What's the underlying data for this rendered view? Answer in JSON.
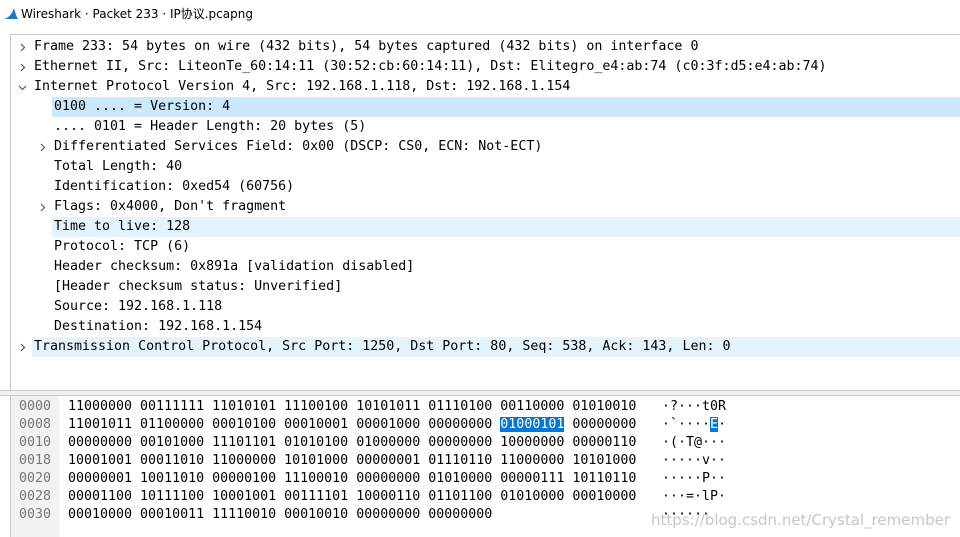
{
  "window": {
    "title": "Wireshark · Packet 233 · IP协议.pcapng",
    "icon": "wireshark-fin-icon",
    "accent": "#1679c5"
  },
  "colors": {
    "selected_row": "#cce8ff",
    "related_row": "#e5f3ff",
    "selected_byte": "#0078d7"
  },
  "tree": {
    "rows": [
      {
        "text": "Frame 233: 54 bytes on wire (432 bits), 54 bytes captured (432 bits) on interface 0",
        "level": 0,
        "toggle": "collapsed",
        "state": ""
      },
      {
        "text": "Ethernet II, Src: LiteonTe_60:14:11 (30:52:cb:60:14:11), Dst: Elitegro_e4:ab:74 (c0:3f:d5:e4:ab:74)",
        "level": 0,
        "toggle": "collapsed",
        "state": ""
      },
      {
        "text": "Internet Protocol Version 4, Src: 192.168.1.118, Dst: 192.168.1.154",
        "level": 0,
        "toggle": "expanded",
        "state": ""
      },
      {
        "text": "0100 .... = Version: 4",
        "level": 1,
        "toggle": "none",
        "state": "selected"
      },
      {
        "text": ".... 0101 = Header Length: 20 bytes (5)",
        "level": 1,
        "toggle": "none",
        "state": ""
      },
      {
        "text": "Differentiated Services Field: 0x00 (DSCP: CS0, ECN: Not-ECT)",
        "level": 1,
        "toggle": "collapsed",
        "state": ""
      },
      {
        "text": "Total Length: 40",
        "level": 1,
        "toggle": "none",
        "state": ""
      },
      {
        "text": "Identification: 0xed54 (60756)",
        "level": 1,
        "toggle": "none",
        "state": ""
      },
      {
        "text": "Flags: 0x4000, Don't fragment",
        "level": 1,
        "toggle": "collapsed",
        "state": ""
      },
      {
        "text": "Time to live: 128",
        "level": 1,
        "toggle": "none",
        "state": "highlight"
      },
      {
        "text": "Protocol: TCP (6)",
        "level": 1,
        "toggle": "none",
        "state": ""
      },
      {
        "text": "Header checksum: 0x891a [validation disabled]",
        "level": 1,
        "toggle": "none",
        "state": ""
      },
      {
        "text": "[Header checksum status: Unverified]",
        "level": 1,
        "toggle": "none",
        "state": ""
      },
      {
        "text": "Source: 192.168.1.118",
        "level": 1,
        "toggle": "none",
        "state": ""
      },
      {
        "text": "Destination: 192.168.1.154",
        "level": 1,
        "toggle": "none",
        "state": ""
      },
      {
        "text": "Transmission Control Protocol, Src Port: 1250, Dst Port: 80, Seq: 538, Ack: 143, Len: 0",
        "level": 0,
        "toggle": "collapsed",
        "state": "highlight"
      }
    ]
  },
  "bytes": {
    "rows": [
      {
        "offset": "0000",
        "pre": "11000000 00111111 11010101 11100100 10101011 01110100 00110000 01010010",
        "sel": "",
        "post": "",
        "ascii_pre": "·?···t0R",
        "ascii_sel": "",
        "ascii_post": ""
      },
      {
        "offset": "0008",
        "pre": "11001011 01100000 00010100 00010001 00001000 00000000 ",
        "sel": "01000101",
        "post": " 00000000",
        "ascii_pre": "·`····",
        "ascii_sel": "E",
        "ascii_post": "·"
      },
      {
        "offset": "0010",
        "pre": "00000000 00101000 11101101 01010100 01000000 00000000 10000000 00000110",
        "sel": "",
        "post": "",
        "ascii_pre": "·(·T@···",
        "ascii_sel": "",
        "ascii_post": ""
      },
      {
        "offset": "0018",
        "pre": "10001001 00011010 11000000 10101000 00000001 01110110 11000000 10101000",
        "sel": "",
        "post": "",
        "ascii_pre": "·····v··",
        "ascii_sel": "",
        "ascii_post": ""
      },
      {
        "offset": "0020",
        "pre": "00000001 10011010 00000100 11100010 00000000 01010000 00000111 10110110",
        "sel": "",
        "post": "",
        "ascii_pre": "·····P··",
        "ascii_sel": "",
        "ascii_post": ""
      },
      {
        "offset": "0028",
        "pre": "00001100 10111100 10001001 00111101 10000110 01101100 01010000 00010000",
        "sel": "",
        "post": "",
        "ascii_pre": "···=·lP·",
        "ascii_sel": "",
        "ascii_post": ""
      },
      {
        "offset": "0030",
        "pre": "00010000 00010011 11110010 00010010 00000000 00000000",
        "sel": "",
        "post": "",
        "ascii_pre": "······",
        "ascii_sel": "",
        "ascii_post": ""
      }
    ]
  },
  "watermark": "https://blog.csdn.net/Crystal_remember"
}
